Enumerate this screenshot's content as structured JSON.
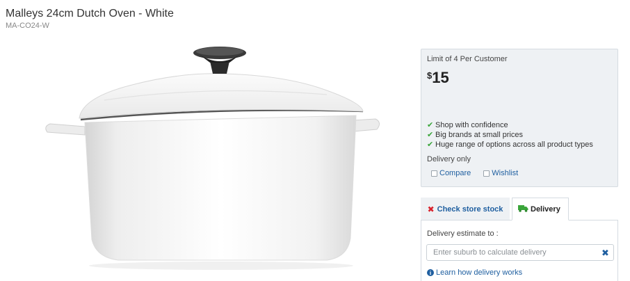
{
  "product": {
    "title": "Malleys 24cm Dutch Oven - White",
    "sku": "MA-CO24-W"
  },
  "image": {
    "subject": "white dutch oven with black knob lid"
  },
  "price_panel": {
    "limit": "Limit of 4 Per Customer",
    "currency": "$",
    "amount": "15",
    "benefits": [
      "Shop with confidence",
      "Big brands at small prices",
      "Huge range of options across all product types"
    ],
    "delivery_note": "Delivery only",
    "compare_label": "Compare",
    "wishlist_label": "Wishlist"
  },
  "tabs": {
    "check_store": "Check store stock",
    "delivery": "Delivery"
  },
  "delivery": {
    "estimate_label": "Delivery estimate to :",
    "placeholder": "Enter suburb to calculate delivery",
    "learn_link": "Learn how delivery works"
  },
  "colors": {
    "link": "#1f5fa0",
    "tick": "#3aa53a",
    "cross": "#d9232d",
    "panel_bg": "#eef1f4"
  },
  "icons": [
    "tick-icon",
    "close-icon",
    "truck-icon",
    "clear-icon",
    "info-icon"
  ]
}
